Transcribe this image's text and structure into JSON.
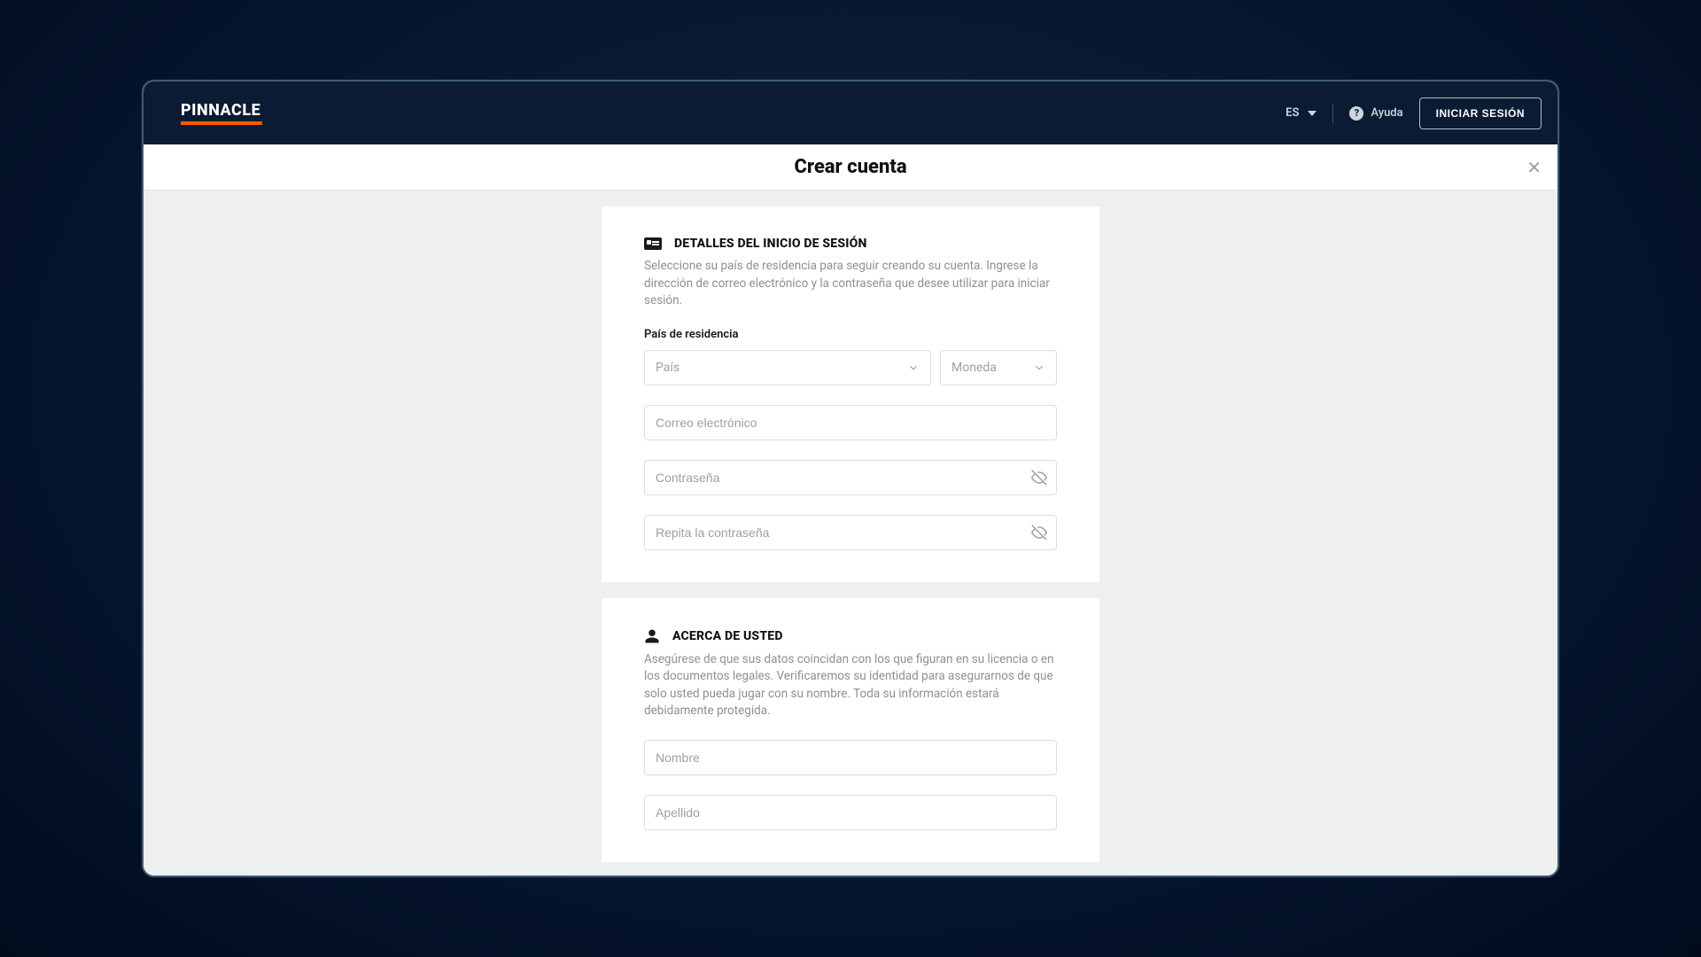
{
  "header": {
    "brand": "PINNACLE",
    "language": "ES",
    "help_label": "Ayuda",
    "login_label": "INICIAR SESIÓN"
  },
  "titlebar": {
    "title": "Crear cuenta"
  },
  "login_details": {
    "title": "DETALLES DEL INICIO DE SESIÓN",
    "description": "Seleccione su país de residencia para seguir creando su cuenta. Ingrese la dirección de correo electrónico y la contraseña que desee utilizar para iniciar sesión.",
    "residence_label": "País de residencia",
    "country_placeholder": "País",
    "currency_placeholder": "Moneda",
    "email_placeholder": "Correo electrónico",
    "password_placeholder": "Contraseña",
    "repeat_password_placeholder": "Repita la contraseña"
  },
  "about_you": {
    "title": "ACERCA DE USTED",
    "description": "Asegúrese de que sus datos coincidan con los que figuran en su licencia o en los documentos legales. Verificaremos su identidad para asegurarnos de que solo usted pueda jugar con su nombre. Toda su información estará debidamente protegida.",
    "firstname_placeholder": "Nombre",
    "lastname_placeholder": "Apellido"
  }
}
